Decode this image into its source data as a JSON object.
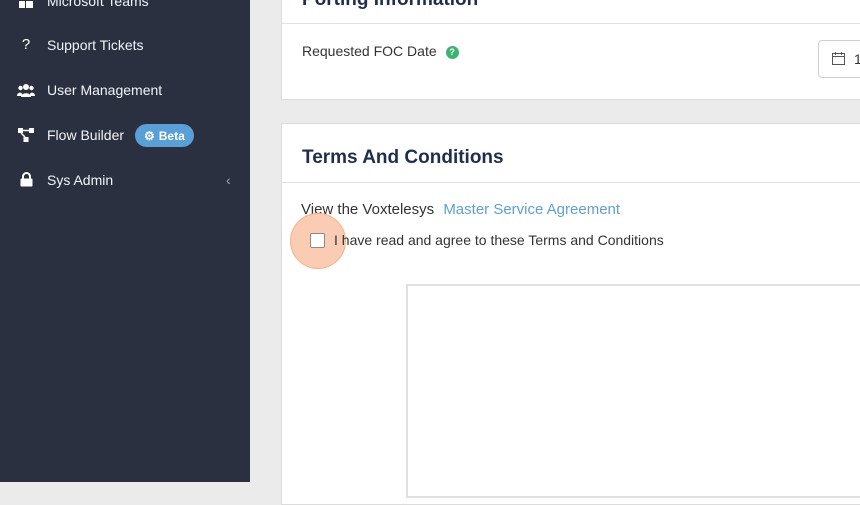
{
  "sidebar": {
    "items": [
      {
        "label": "Microsoft Teams",
        "icon": "windows-icon"
      },
      {
        "label": "Support Tickets",
        "icon": "question-icon"
      },
      {
        "label": "User Management",
        "icon": "users-icon"
      },
      {
        "label": "Flow Builder",
        "icon": "flow-icon",
        "badge": "Beta"
      },
      {
        "label": "Sys Admin",
        "icon": "lock-icon",
        "chevron": "‹"
      }
    ]
  },
  "porting": {
    "title": "Porting Information",
    "foc_label": "Requested FOC Date",
    "help_glyph": "?",
    "date_value": "1"
  },
  "terms": {
    "title": "Terms And Conditions",
    "view_prefix": "View the Voxtelesys",
    "link_text": "Master Service Agreement",
    "agree_label": "I have read and agree to these Terms and Conditions",
    "agreed": false
  },
  "colors": {
    "sidebar_bg": "#2b3040",
    "accent": "#5f9fd1",
    "help_green": "#3cb371",
    "title_navy": "#1f2f4b"
  }
}
